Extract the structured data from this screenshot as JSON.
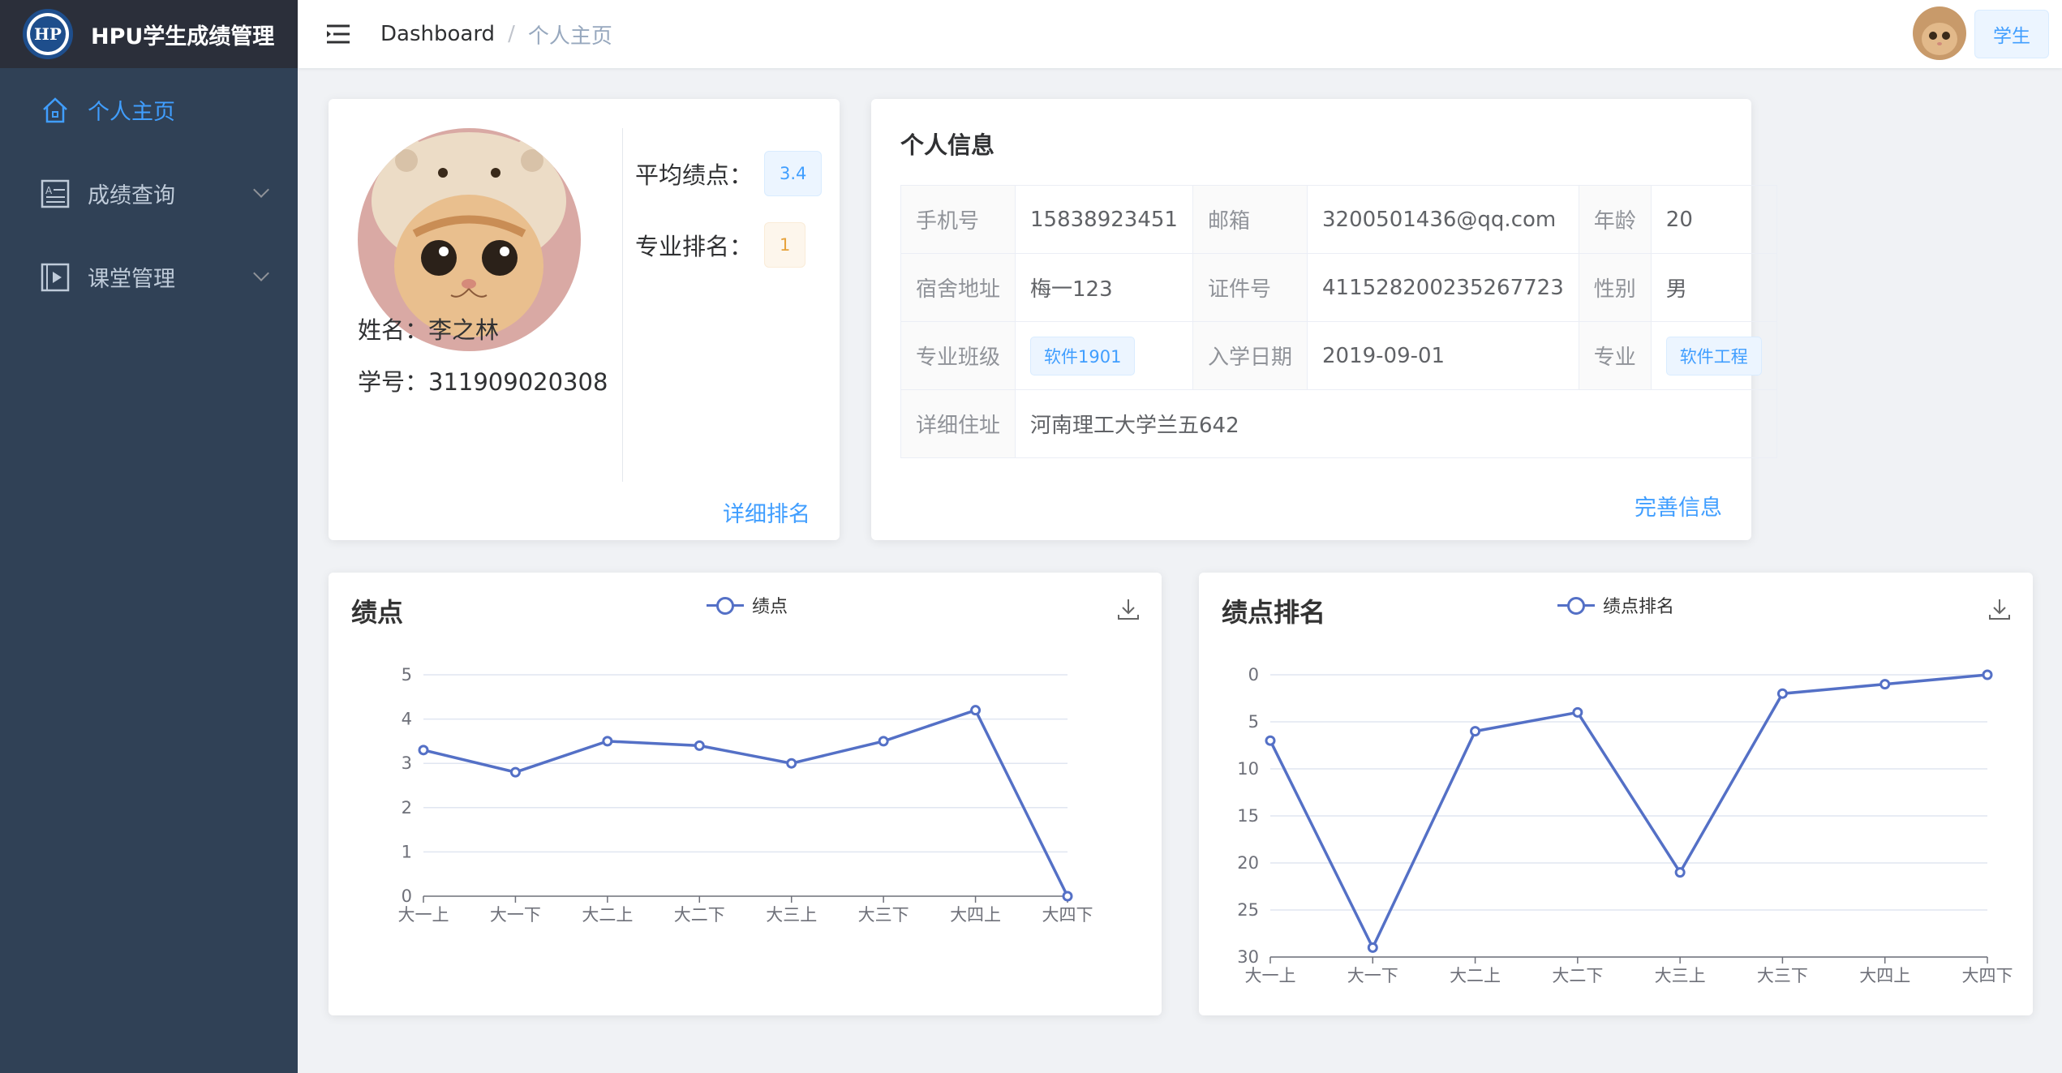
{
  "app": {
    "title": "HPU学生成绩管理",
    "logo_text": "HP"
  },
  "sidebar": {
    "items": [
      {
        "label": "个人主页",
        "icon": "home-icon",
        "active": true
      },
      {
        "label": "成绩查询",
        "icon": "score-list-icon",
        "active": false
      },
      {
        "label": "课堂管理",
        "icon": "video-play-icon",
        "active": false
      }
    ]
  },
  "header": {
    "breadcrumb": [
      "Dashboard",
      "个人主页"
    ],
    "separator": "/",
    "role": "学生"
  },
  "profile": {
    "name_line": "姓名：李之林",
    "id_line": "学号：311909020308",
    "gpa_label": "平均绩点：",
    "gpa_value": "3.4",
    "rank_label": "专业排名：",
    "rank_value": "1",
    "detail_link": "详细排名"
  },
  "info": {
    "title": "个人信息",
    "phone_label": "手机号",
    "phone": "15838923451",
    "email_label": "邮箱",
    "email": "3200501436@qq.com",
    "age_label": "年龄",
    "age": "20",
    "dorm_label": "宿舍地址",
    "dorm": "梅一123",
    "idno_label": "证件号",
    "idno": "411528200235267723",
    "gender_label": "性别",
    "gender": "男",
    "class_label": "专业班级",
    "class": "软件1901",
    "enroll_label": "入学日期",
    "enroll": "2019-09-01",
    "major_label": "专业",
    "major": "软件工程",
    "address_label": "详细住址",
    "address": "河南理工大学兰五642",
    "complete_link": "完善信息"
  },
  "chart_data": [
    {
      "type": "line",
      "title": "绩点",
      "categories": [
        "大一上",
        "大一下",
        "大二上",
        "大二下",
        "大三上",
        "大三下",
        "大四上",
        "大四下"
      ],
      "series": [
        {
          "name": "绩点",
          "values": [
            3.3,
            2.8,
            3.5,
            3.4,
            3.0,
            3.5,
            4.2,
            0
          ]
        }
      ],
      "y_ticks": [
        0,
        1,
        2,
        3,
        4,
        5
      ],
      "ylim": [
        0,
        5
      ],
      "inverse": false,
      "grid": true,
      "legend": "top-center"
    },
    {
      "type": "line",
      "title": "绩点排名",
      "categories": [
        "大一上",
        "大一下",
        "大二上",
        "大二下",
        "大三上",
        "大三下",
        "大四上",
        "大四下"
      ],
      "series": [
        {
          "name": "绩点排名",
          "values": [
            7,
            29,
            6,
            4,
            21,
            2,
            1,
            0
          ]
        }
      ],
      "y_ticks": [
        0,
        5,
        10,
        15,
        20,
        25,
        30
      ],
      "ylim": [
        0,
        30
      ],
      "inverse": true,
      "grid": true,
      "legend": "top-center"
    }
  ],
  "colors": {
    "series": "#5470c6",
    "accent": "#409eff",
    "sidebar": "#304156"
  }
}
